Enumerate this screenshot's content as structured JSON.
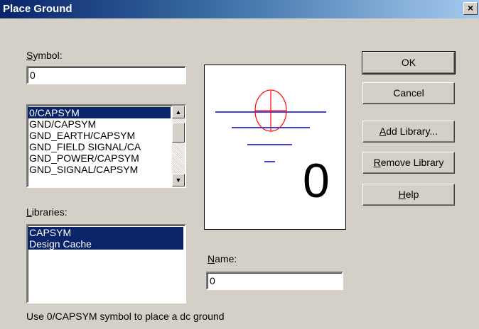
{
  "window": {
    "title": "Place Ground",
    "close_glyph": "×"
  },
  "symbol": {
    "label_prefix": "S",
    "label_rest": "ymbol:",
    "value": "0"
  },
  "symbols_list": {
    "items": [
      "0/CAPSYM",
      "GND/CAPSYM",
      "GND_EARTH/CAPSYM",
      "GND_FIELD SIGNAL/CA",
      "GND_POWER/CAPSYM",
      "GND_SIGNAL/CAPSYM"
    ],
    "selected_index": 0
  },
  "libraries": {
    "label_prefix": "L",
    "label_rest": "ibraries:",
    "items": [
      "CAPSYM",
      "Design Cache"
    ],
    "selected": [
      0,
      1
    ]
  },
  "name_field": {
    "label_prefix": "N",
    "label_rest": "ame:",
    "value": "0"
  },
  "preview": {
    "symbol_text": "0",
    "colors": {
      "ground": "#0000cc",
      "circle": "#ff0000"
    }
  },
  "buttons": {
    "ok": "OK",
    "cancel": "Cancel",
    "add_library_prefix": "A",
    "add_library_rest": "dd Library...",
    "remove_library_prefix": "R",
    "remove_library_rest": "emove Library",
    "help_prefix": "H",
    "help_rest": "elp"
  },
  "status_text": "Use 0/CAPSYM symbol to place a dc ground"
}
